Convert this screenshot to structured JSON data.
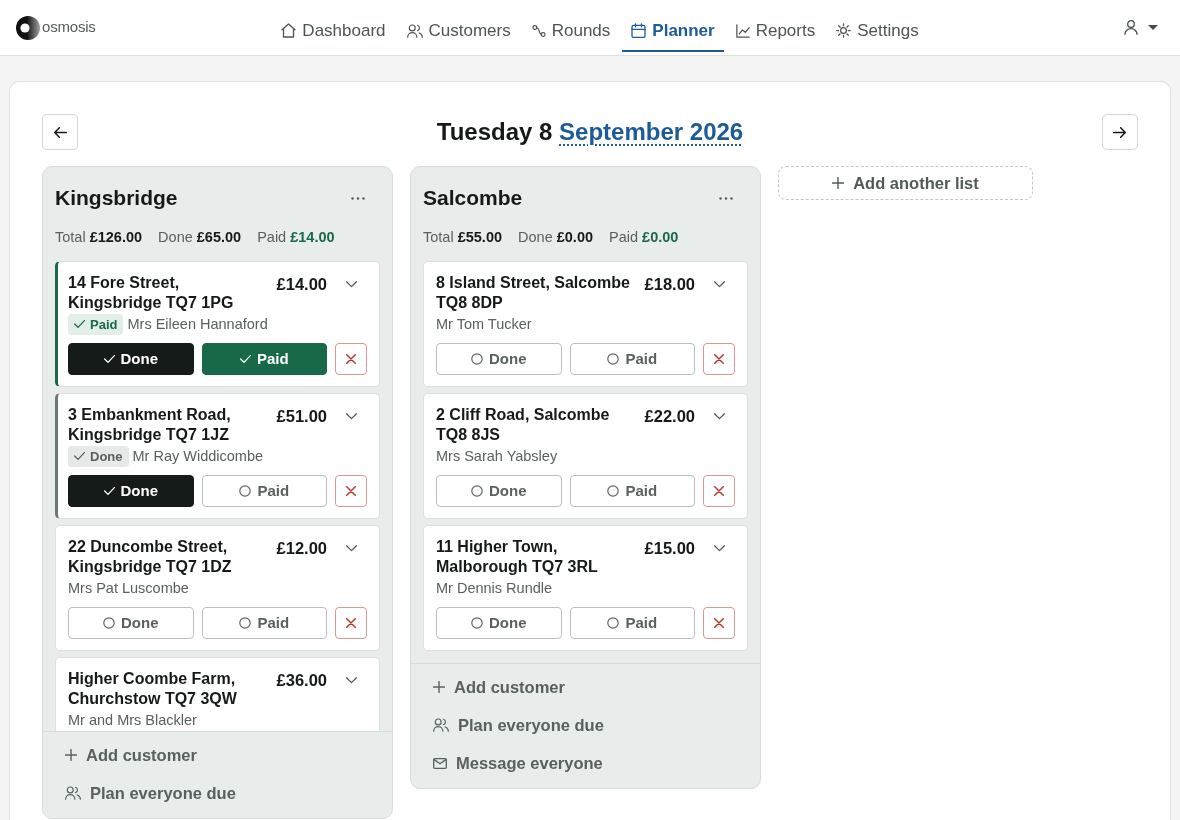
{
  "app": {
    "name": "osmosis"
  },
  "nav": [
    {
      "kind": "dashboard",
      "label": "Dashboard",
      "selected": false
    },
    {
      "kind": "customers",
      "label": "Customers",
      "selected": false
    },
    {
      "kind": "rounds",
      "label": "Rounds",
      "selected": false
    },
    {
      "kind": "planner",
      "label": "Planner",
      "selected": true
    },
    {
      "kind": "reports",
      "label": "Reports",
      "selected": false
    },
    {
      "kind": "settings",
      "label": "Settings",
      "selected": false
    }
  ],
  "header": {
    "day": "Tuesday 8",
    "month": "September 2026"
  },
  "lists": [
    {
      "title": "Kingsbridge",
      "totals": [
        {
          "kind": "total",
          "label": "Total",
          "amount": "£126.00"
        },
        {
          "kind": "done",
          "label": "Done",
          "amount": "£65.00"
        },
        {
          "kind": "paid",
          "label": "Paid",
          "amount": "£14.00"
        }
      ],
      "stops": [
        {
          "address": "14 Fore Street, Kingsbridge",
          "postcode": "TQ7 1PG",
          "price": "£14.00",
          "status": {
            "kind": "paid",
            "label": "Paid"
          },
          "customer": "Mrs Eileen Hannaford",
          "done": {
            "label": "Done",
            "checked": true
          },
          "paid": {
            "label": "Paid",
            "checked": true
          }
        },
        {
          "address": "3 Embankment Road, Kingsbridge",
          "postcode": "TQ7 1JZ",
          "price": "£51.00",
          "status": {
            "kind": "done",
            "label": "Done"
          },
          "customer": "Mr Ray Widdicombe",
          "done": {
            "label": "Done",
            "checked": true
          },
          "paid": {
            "label": "Paid",
            "checked": false
          }
        },
        {
          "address": "22 Duncombe Street, Kingsbridge",
          "postcode": "TQ7 1DZ",
          "price": "£12.00",
          "customer": "Mrs Pat Luscombe",
          "done": {
            "label": "Done",
            "checked": false
          },
          "paid": {
            "label": "Paid",
            "checked": false
          }
        },
        {
          "address": "Higher Coombe Farm, Churchstow",
          "postcode": "TQ7 3QW",
          "price": "£36.00",
          "customer": "Mr and Mrs Blackler"
        }
      ],
      "actions": [
        {
          "kind": "add",
          "label": "Add customer"
        },
        {
          "kind": "plan",
          "label": "Plan everyone due"
        }
      ]
    },
    {
      "title": "Salcombe",
      "totals": [
        {
          "kind": "total",
          "label": "Total",
          "amount": "£55.00"
        },
        {
          "kind": "done",
          "label": "Done",
          "amount": "£0.00"
        },
        {
          "kind": "paid",
          "label": "Paid",
          "amount": "£0.00"
        }
      ],
      "stops": [
        {
          "address": "8 Island Street, Salcombe",
          "postcode": "TQ8 8DP",
          "price": "£18.00",
          "customer": "Mr Tom Tucker",
          "done": {
            "label": "Done",
            "checked": false
          },
          "paid": {
            "label": "Paid",
            "checked": false
          }
        },
        {
          "address": "2 Cliff Road, Salcombe",
          "postcode": "TQ8 8JS",
          "price": "£22.00",
          "customer": "Mrs Sarah Yabsley",
          "done": {
            "label": "Done",
            "checked": false
          },
          "paid": {
            "label": "Paid",
            "checked": false
          }
        },
        {
          "address": "11 Higher Town, Malborough",
          "postcode": "TQ7 3RL",
          "price": "£15.00",
          "customer": "Mr Dennis Rundle",
          "done": {
            "label": "Done",
            "checked": false
          },
          "paid": {
            "label": "Paid",
            "checked": false
          }
        }
      ],
      "actions": [
        {
          "kind": "add",
          "label": "Add customer"
        },
        {
          "kind": "plan",
          "label": "Plan everyone due"
        },
        {
          "kind": "message",
          "label": "Message everyone"
        }
      ]
    }
  ],
  "add_list": {
    "label": "Add another list"
  }
}
